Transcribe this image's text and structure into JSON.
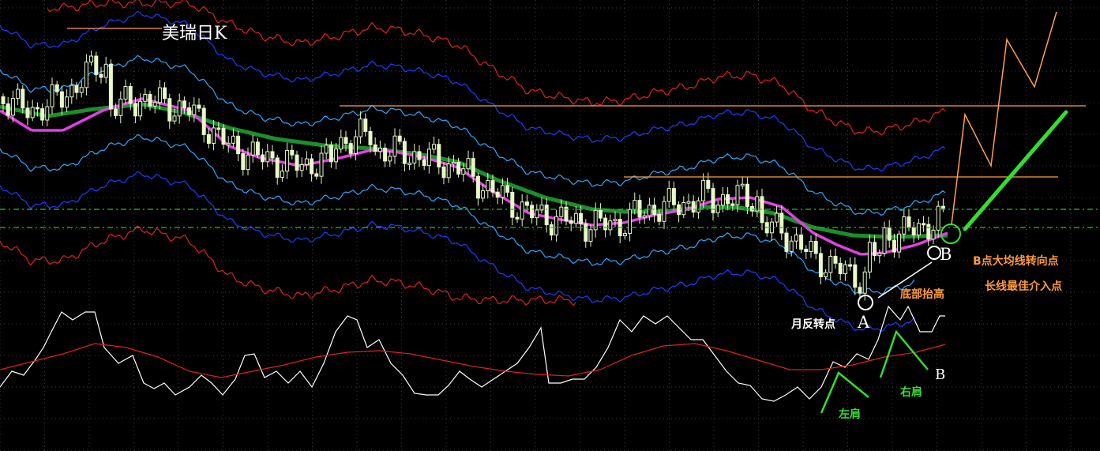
{
  "chart_data": {
    "type": "candlestick",
    "title": "美瑞日K",
    "colors": {
      "background": "#000000",
      "candle": "#e8f8c8",
      "ma_fast": "#e040e0",
      "ma_slow": "#1a8f2a",
      "band_inner": "#2aa8ff",
      "band_mid": "#1e3cff",
      "band_outer": "#e02020",
      "resistance": "#ffa040",
      "dashed": "#27c027",
      "projection_orange": "#ffa040",
      "projection_green": "#33dd33",
      "oscillator": "#ffffff",
      "oscillator_signal": "#e02020",
      "grid": "#3c3c3c"
    },
    "grid": true,
    "annotations": {
      "b_turn_point": "B点大均线转向点",
      "best_entry": "长线最佳介入点",
      "bottom_raised": "底部抬高",
      "monthly_reversal": "月反转点",
      "point_a": "A",
      "point_b": "B",
      "point_b_oscillator": "B",
      "left_shoulder": "左肩",
      "right_shoulder": "右肩"
    }
  }
}
